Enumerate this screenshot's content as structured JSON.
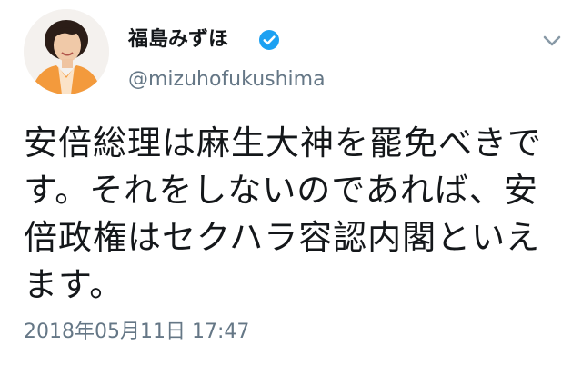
{
  "author": {
    "display_name": "福島みずほ",
    "handle": "@mizuhofukushima",
    "verified": true,
    "verified_color": "#1da1f2"
  },
  "tweet": {
    "text_lines": [
      "安倍総理は麻生大神を罷免べきで",
      "す。それをしないのであれば、安",
      "倍政権はセクハラ容認内閣といえ",
      "ます。"
    ],
    "timestamp": "2018年05月11日 17:47"
  },
  "icons": {
    "verified": "verified-badge-icon",
    "menu": "chevron-down-icon",
    "avatar": "profile-photo"
  },
  "colors": {
    "text": "#14171a",
    "secondary_text": "#657786",
    "accent": "#1da1f2",
    "avatar_jacket": "#f39a3c"
  }
}
